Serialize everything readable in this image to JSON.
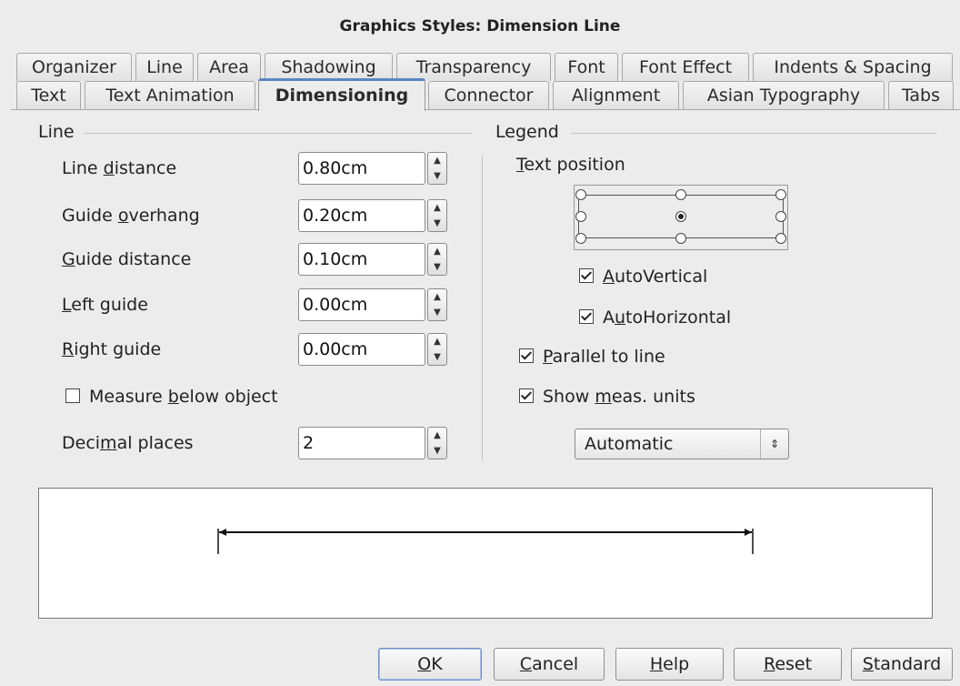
{
  "window": {
    "title": "Graphics Styles: Dimension Line"
  },
  "tabs_row1": [
    "Organizer",
    "Line",
    "Area",
    "Shadowing",
    "Transparency",
    "Font",
    "Font Effect",
    "Indents & Spacing"
  ],
  "tabs_row2": [
    "Text",
    "Text Animation",
    "Dimensioning",
    "Connector",
    "Alignment",
    "Asian Typography",
    "Tabs"
  ],
  "active_tab": "Dimensioning",
  "line_section": {
    "title": "Line",
    "fields": [
      {
        "label_pre": "Line ",
        "label_u": "d",
        "label_post": "istance",
        "value": "0.80cm"
      },
      {
        "label_pre": "Guide ",
        "label_u": "o",
        "label_post": "verhang",
        "value": "0.20cm"
      },
      {
        "label_pre": "",
        "label_u": "G",
        "label_post": "uide distance",
        "value": "0.10cm"
      },
      {
        "label_pre": "",
        "label_u": "L",
        "label_post": "eft guide",
        "value": "0.00cm"
      },
      {
        "label_pre": "",
        "label_u": "R",
        "label_post": "ight guide",
        "value": "0.00cm"
      }
    ],
    "measure_below": {
      "label_pre": "Measure ",
      "label_u": "b",
      "label_post": "elow object",
      "checked": false
    },
    "decimal": {
      "label_pre": "Deci",
      "label_u": "m",
      "label_post": "al places",
      "value": "2"
    }
  },
  "legend_section": {
    "title": "Legend",
    "text_position": {
      "label_u": "T",
      "label_post": "ext position"
    },
    "auto_vertical": {
      "label_u": "A",
      "label_post": "utoVertical",
      "checked": true
    },
    "auto_horizontal": {
      "label_pre": "A",
      "label_u": "u",
      "label_post": "toHorizontal",
      "checked": true
    },
    "parallel": {
      "label_u": "P",
      "label_post": "arallel to line",
      "checked": true
    },
    "show_units": {
      "label_pre": "Show ",
      "label_u": "m",
      "label_post": "eas. units",
      "checked": true
    },
    "units_value": "Automatic"
  },
  "buttons": {
    "ok": {
      "u": "O",
      "rest": "K"
    },
    "cancel": {
      "u": "C",
      "rest": "ancel"
    },
    "help": {
      "u": "H",
      "rest": "elp"
    },
    "reset": {
      "u": "R",
      "rest": "eset"
    },
    "standard": {
      "u": "S",
      "rest": "tandard"
    }
  },
  "icons": [
    "spin-up-icon",
    "spin-down-icon",
    "dropdown-updown-icon",
    "checkbox-icon",
    "radio-icon"
  ]
}
